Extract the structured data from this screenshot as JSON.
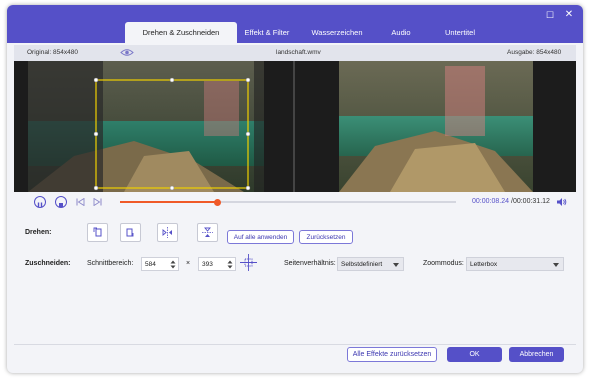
{
  "tabs": [
    {
      "label": "Drehen & Zuschneiden",
      "active": true
    },
    {
      "label": "Effekt & Filter",
      "active": false
    },
    {
      "label": "Wasserzeichen",
      "active": false
    },
    {
      "label": "Audio",
      "active": false
    },
    {
      "label": "Untertitel",
      "active": false
    }
  ],
  "window_controls": {
    "maximize": "☐",
    "close": "✕"
  },
  "infobar": {
    "original_label": "Original: 854x480",
    "filename": "landschaft.wmv",
    "output_label": "Ausgabe: 854x480"
  },
  "playback": {
    "current_time": "00:00:08.24",
    "total_time": "/00:00:31.12",
    "progress": 0.29
  },
  "rotate": {
    "label": "Drehen:",
    "apply_all": "Auf alle anwenden",
    "reset": "Zurücksetzen"
  },
  "crop": {
    "label": "Zuschneiden:",
    "area_label": "Schnittbereich:",
    "width_value": "584",
    "times": "×",
    "height_value": "393",
    "aspect_label": "Seitenverhältnis:",
    "aspect_value": "Selbstdefiniert",
    "zoom_label": "Zoommodus:",
    "zoom_value": "Letterbox"
  },
  "footer": {
    "reset_all": "Alle Effekte zurücksetzen",
    "ok": "OK",
    "cancel": "Abbrechen"
  },
  "colors": {
    "accent": "#5550c8",
    "crop_box": "#f0d000",
    "progress": "#f05a28"
  },
  "icons": [
    "eye-icon",
    "pause-icon",
    "stop-icon",
    "prev-frame-icon",
    "next-frame-icon",
    "volume-icon",
    "rotate-left-icon",
    "rotate-right-icon",
    "flip-horizontal-icon",
    "flip-vertical-icon",
    "center-crop-icon"
  ]
}
